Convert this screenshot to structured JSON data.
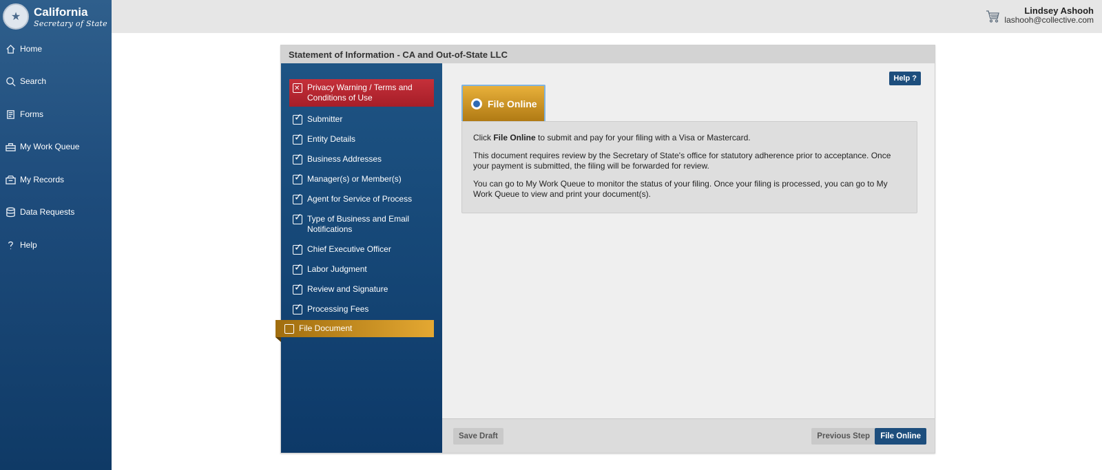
{
  "brand": {
    "title": "California",
    "subtitle": "Secretary of State"
  },
  "nav": {
    "items": [
      {
        "label": "Home",
        "icon": "home-icon"
      },
      {
        "label": "Search",
        "icon": "search-icon"
      },
      {
        "label": "Forms",
        "icon": "forms-icon"
      },
      {
        "label": "My Work Queue",
        "icon": "work-queue-icon"
      },
      {
        "label": "My Records",
        "icon": "records-icon"
      },
      {
        "label": "Data Requests",
        "icon": "database-icon"
      },
      {
        "label": "Help",
        "icon": "question-icon"
      }
    ]
  },
  "header": {
    "user_name": "Lindsey Ashooh",
    "user_email": "lashooh@collective.com",
    "cart_icon": "cart-icon"
  },
  "panel": {
    "title": "Statement of Information - CA and Out-of-State LLC"
  },
  "steps": [
    {
      "label": "Privacy Warning / Terms and Conditions of Use",
      "state": "error"
    },
    {
      "label": "Submitter",
      "state": "done"
    },
    {
      "label": "Entity Details",
      "state": "done"
    },
    {
      "label": "Business Addresses",
      "state": "done"
    },
    {
      "label": "Manager(s) or Member(s)",
      "state": "done"
    },
    {
      "label": "Agent for Service of Process",
      "state": "done"
    },
    {
      "label": "Type of Business and Email Notifications",
      "state": "done"
    },
    {
      "label": "Chief Executive Officer",
      "state": "done"
    },
    {
      "label": "Labor Judgment",
      "state": "done"
    },
    {
      "label": "Review and Signature",
      "state": "done"
    },
    {
      "label": "Processing Fees",
      "state": "done"
    },
    {
      "label": "File Document",
      "state": "current"
    }
  ],
  "content": {
    "help_label": "Help ?",
    "tab_label": "File Online",
    "para1_prefix": "Click ",
    "para1_bold": "File Online",
    "para1_suffix": " to submit and pay for your filing with a Visa or Mastercard.",
    "para2": "This document requires review by the Secretary of State's office for statutory adherence prior to acceptance. Once your payment is submitted, the filing will be forwarded for review.",
    "para3": "You can go to My Work Queue to monitor the status of your filing. Once your filing is processed, you can go to My Work Queue to view and print your document(s)."
  },
  "footer": {
    "save_label": "Save Draft",
    "prev_label": "Previous Step",
    "submit_label": "File Online"
  }
}
